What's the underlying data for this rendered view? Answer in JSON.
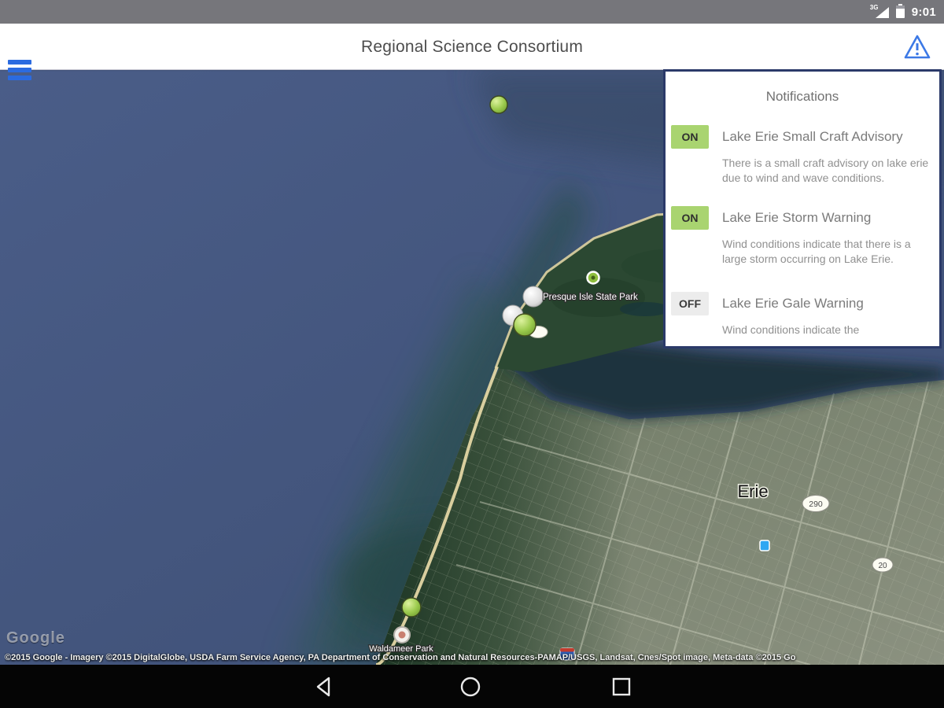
{
  "status_bar": {
    "network": "3G",
    "time": "9:01"
  },
  "header": {
    "title": "Regional Science Consortium"
  },
  "notifications": {
    "title": "Notifications",
    "items": [
      {
        "state": "ON",
        "title": "Lake Erie Small Craft Advisory",
        "description": "There is a small craft advisory on lake erie due to wind and wave conditions."
      },
      {
        "state": "ON",
        "title": "Lake Erie Storm Warning",
        "description": "Wind conditions indicate that there is a large storm occurring on Lake Erie."
      },
      {
        "state": "OFF",
        "title": "Lake Erie Gale Warning",
        "description": "Wind conditions indicate the"
      }
    ]
  },
  "map": {
    "labels": {
      "park": "Presque Isle State Park",
      "city": "Erie",
      "amusement_park": "Waldameer Park",
      "google_logo": "Google",
      "attribution": "©2015 Google - Imagery ©2015 DigitalGlobe, USDA Farm Service Agency, PA Department of Conservation and Natural Resources-PAMAP/USGS, Landsat, Cnes/Spot image, Meta-data ©2015 Go"
    },
    "route_shields": [
      "290",
      "20"
    ]
  },
  "colors": {
    "accent_blue": "#2b6be0",
    "toggle_on": "#a9d470",
    "toggle_off": "#ececec",
    "marker_green": "#9ccb4e",
    "panel_border": "#2b3a69",
    "status_bar_gray": "#76767b"
  }
}
